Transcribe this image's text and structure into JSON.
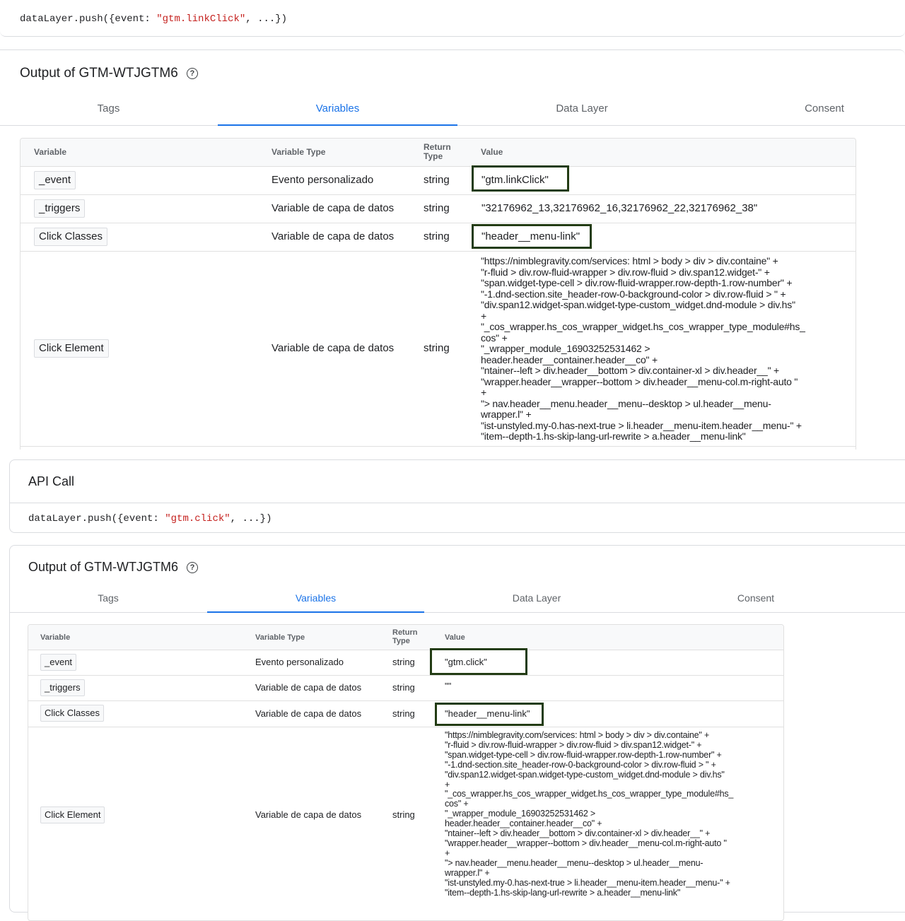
{
  "top": {
    "api_call_code": "dataLayer.push({event: \"gtm.linkClick\", ...})"
  },
  "output1": {
    "title": "Output of GTM-WTJGTM6",
    "tabs": [
      "Tags",
      "Variables",
      "Data Layer",
      "Consent"
    ],
    "active_tab": "Variables",
    "headers": {
      "variable": "Variable",
      "type": "Variable Type",
      "return": "Return\nType",
      "value": "Value"
    },
    "rows": [
      {
        "name": "_event",
        "type": "Evento personalizado",
        "return": "string",
        "value": "\"gtm.linkClick\""
      },
      {
        "name": "_triggers",
        "type": "Variable de capa de datos",
        "return": "string",
        "value": "\"32176962_13,32176962_16,32176962_22,32176962_38\""
      },
      {
        "name": "Click Classes",
        "type": "Variable de capa de datos",
        "return": "string",
        "value": "\"header__menu-link\""
      },
      {
        "name": "Click Element",
        "type": "Variable de capa de datos",
        "return": "string",
        "value": "\"https://nimblegravity.com/services: html > body > div > div.containe\" +\n\"r-fluid > div.row-fluid-wrapper > div.row-fluid > div.span12.widget-\" +\n\"span.widget-type-cell > div.row-fluid-wrapper.row-depth-1.row-number\" +\n\"-1.dnd-section.site_header-row-0-background-color > div.row-fluid > \" +\n\"div.span12.widget-span.widget-type-custom_widget.dnd-module > div.hs\"\n+\n\"_cos_wrapper.hs_cos_wrapper_widget.hs_cos_wrapper_type_module#hs_\ncos\" +\n\"_wrapper_module_16903252531462 >\nheader.header__container.header__co\" +\n\"ntainer--left > div.header__bottom > div.container-xl > div.header__\" +\n\"wrapper.header__wrapper--bottom > div.header__menu-col.m-right-auto \"\n+\n\"> nav.header__menu.header__menu--desktop > ul.header__menu-\nwrapper.l\" +\n\"ist-unstyled.my-0.has-next-true > li.header__menu-item.header__menu-\" +\n\"item--depth-1.hs-skip-lang-url-rewrite > a.header__menu-link\""
      }
    ]
  },
  "api_call": {
    "title": "API Call",
    "code": "dataLayer.push({event: \"gtm.click\", ...})"
  },
  "output2": {
    "title": "Output of GTM-WTJGTM6",
    "tabs": [
      "Tags",
      "Variables",
      "Data Layer",
      "Consent"
    ],
    "active_tab": "Variables",
    "headers": {
      "variable": "Variable",
      "type": "Variable Type",
      "return": "Return\nType",
      "value": "Value"
    },
    "rows": [
      {
        "name": "_event",
        "type": "Evento personalizado",
        "return": "string",
        "value": "\"gtm.click\""
      },
      {
        "name": "_triggers",
        "type": "Variable de capa de datos",
        "return": "string",
        "value": "\"\""
      },
      {
        "name": "Click Classes",
        "type": "Variable de capa de datos",
        "return": "string",
        "value": "\"header__menu-link\""
      },
      {
        "name": "Click Element",
        "type": "Variable de capa de datos",
        "return": "string",
        "value": "\"https://nimblegravity.com/services: html > body > div > div.containe\" +\n\"r-fluid > div.row-fluid-wrapper > div.row-fluid > div.span12.widget-\" +\n\"span.widget-type-cell > div.row-fluid-wrapper.row-depth-1.row-number\" +\n\"-1.dnd-section.site_header-row-0-background-color > div.row-fluid > \" +\n\"div.span12.widget-span.widget-type-custom_widget.dnd-module > div.hs\"\n+\n\"_cos_wrapper.hs_cos_wrapper_widget.hs_cos_wrapper_type_module#hs_\ncos\" +\n\"_wrapper_module_16903252531462 >\nheader.header__container.header__co\" +\n\"ntainer--left > div.header__bottom > div.container-xl > div.header__\" +\n\"wrapper.header__wrapper--bottom > div.header__menu-col.m-right-auto \"\n+\n\"> nav.header__menu.header__menu--desktop > ul.header__menu-\nwrapper.l\" +\n\"ist-unstyled.my-0.has-next-true > li.header__menu-item.header__menu-\" +\n\"item--depth-1.hs-skip-lang-url-rewrite > a.header__menu-link\""
      }
    ]
  },
  "colors": {
    "accent": "#1a73e8",
    "highlight_box": "#233c14",
    "code_string": "#c5221f"
  },
  "icons": {
    "help": "help-circle-icon"
  }
}
